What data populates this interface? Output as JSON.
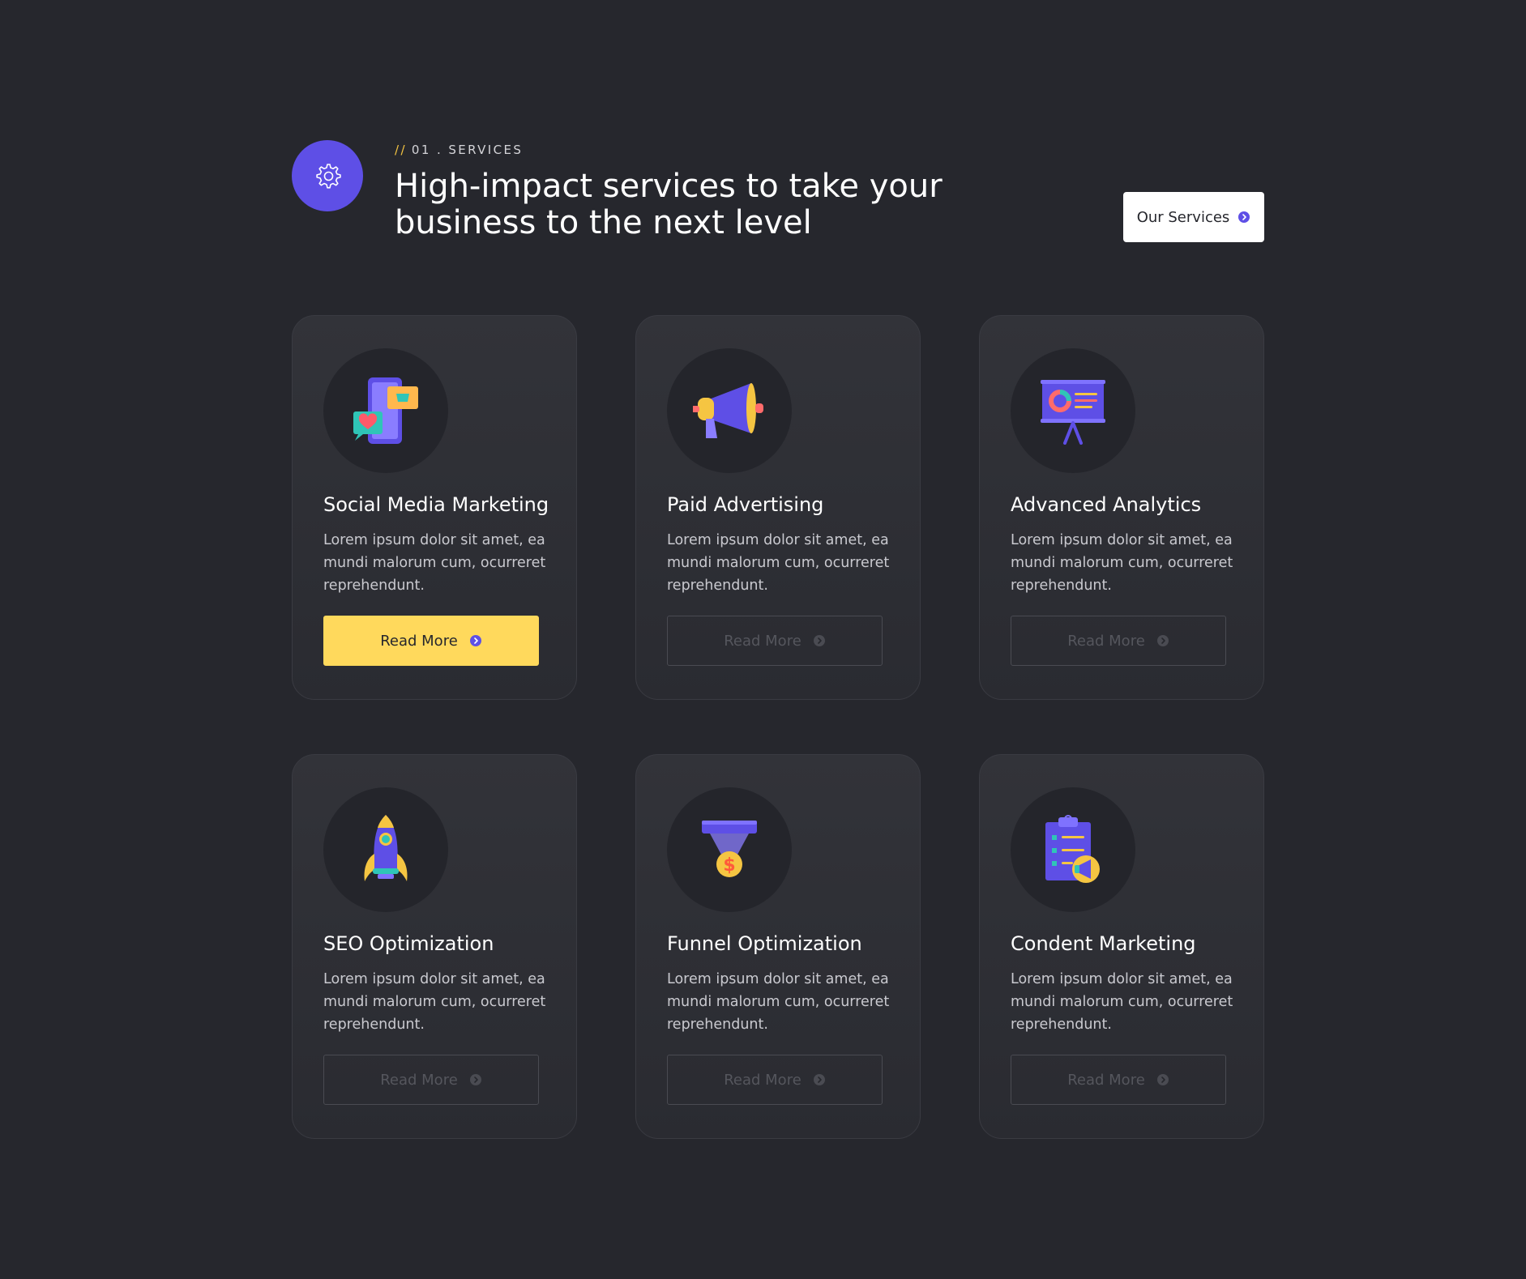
{
  "header": {
    "eyebrow_slashes": "//",
    "eyebrow_label": "01 . SERVICES",
    "headline": "High-impact services to take your business to the next level",
    "cta_label": "Our Services",
    "icon": "gear-icon"
  },
  "colors": {
    "background": "#26272d",
    "accent_purple": "#5e4fe6",
    "accent_yellow": "#ffd95c"
  },
  "cards": [
    {
      "title": "Social Media Marketing",
      "description": "Lorem ipsum dolor sit amet, ea mundi malorum cum, ocurreret reprehendunt.",
      "button": "Read More",
      "icon": "phone-social-icon",
      "active": true
    },
    {
      "title": "Paid Advertising",
      "description": "Lorem ipsum dolor sit amet, ea mundi malorum cum, ocurreret reprehendunt.",
      "button": "Read More",
      "icon": "megaphone-icon",
      "active": false
    },
    {
      "title": "Advanced Analytics",
      "description": "Lorem ipsum dolor sit amet, ea mundi malorum cum, ocurreret reprehendunt.",
      "button": "Read More",
      "icon": "presentation-board-icon",
      "active": false
    },
    {
      "title": "SEO Optimization",
      "description": "Lorem ipsum dolor sit amet, ea mundi malorum cum, ocurreret reprehendunt.",
      "button": "Read More",
      "icon": "rocket-icon",
      "active": false
    },
    {
      "title": "Funnel Optimization",
      "description": "Lorem ipsum dolor sit amet, ea mundi malorum cum, ocurreret reprehendunt.",
      "button": "Read More",
      "icon": "funnel-dollar-icon",
      "active": false
    },
    {
      "title": "Condent Marketing",
      "description": "Lorem ipsum dolor sit amet, ea mundi malorum cum, ocurreret reprehendunt.",
      "button": "Read More",
      "icon": "clipboard-megaphone-icon",
      "active": false
    }
  ]
}
